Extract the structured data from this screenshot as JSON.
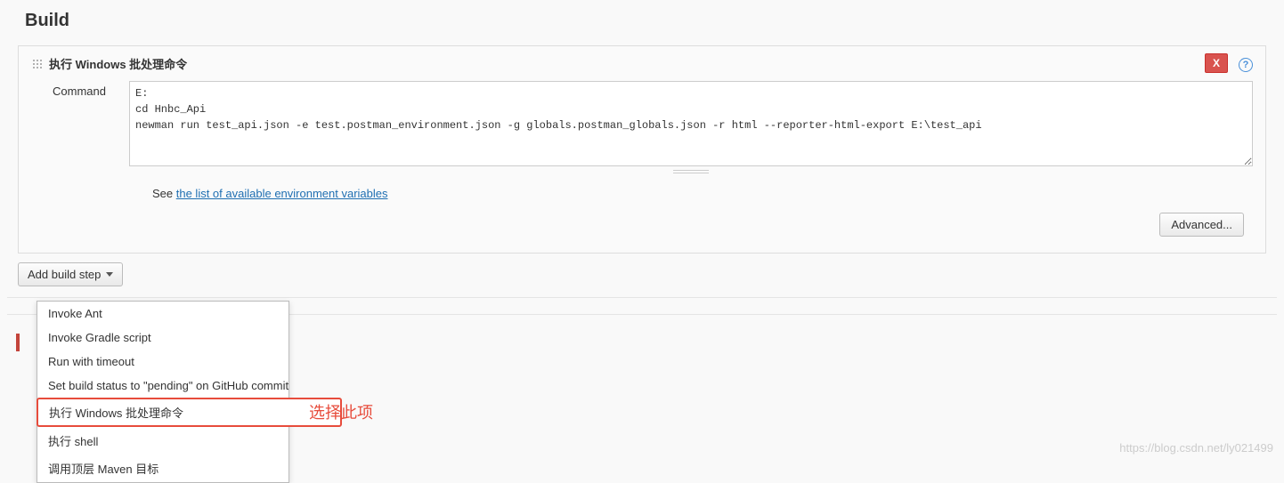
{
  "page": {
    "title": "Build"
  },
  "step": {
    "title": "执行 Windows 批处理命令",
    "delete_label": "X",
    "help_label": "?",
    "command_label": "Command",
    "command_value": "E:\ncd Hnbc_Api\nnewman run test_api.json -e test.postman_environment.json -g globals.postman_globals.json -r html --reporter-html-export E:\\test_api",
    "hint_prefix": "See ",
    "hint_link": "the list of available environment variables",
    "advanced_label": "Advanced..."
  },
  "add_step": {
    "label": "Add build step"
  },
  "menu": {
    "items": [
      {
        "label": "Invoke Ant"
      },
      {
        "label": "Invoke Gradle script"
      },
      {
        "label": "Run with timeout"
      },
      {
        "label": "Set build status to \"pending\" on GitHub commit"
      },
      {
        "label": "执行 Windows 批处理命令"
      },
      {
        "label": "执行 shell"
      },
      {
        "label": "调用顶层 Maven 目标"
      }
    ]
  },
  "annotation": {
    "text": "选择此项"
  },
  "watermark": {
    "text": "https://blog.csdn.net/ly021499"
  }
}
